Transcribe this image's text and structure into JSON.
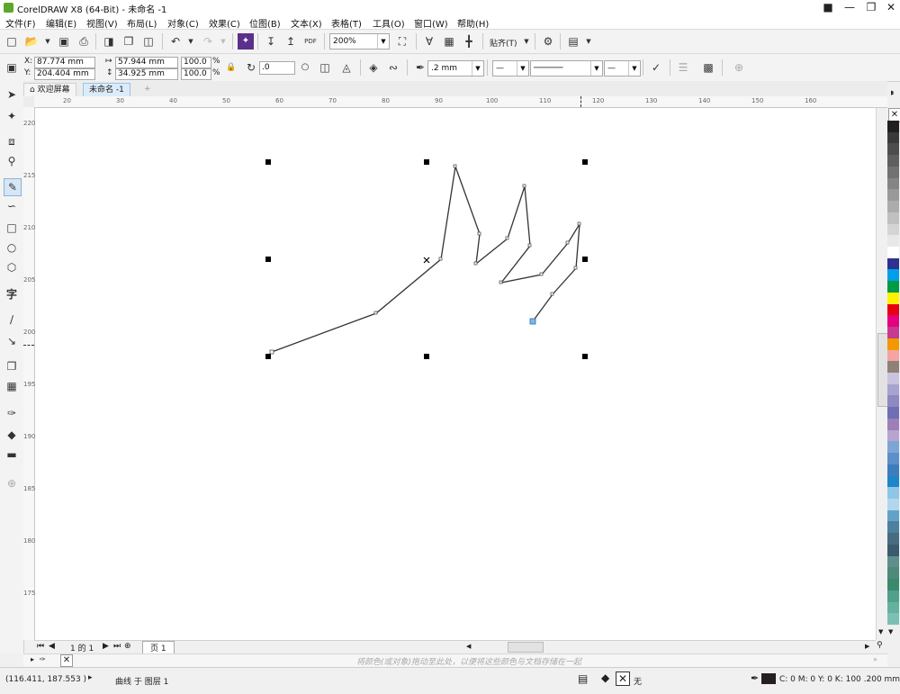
{
  "window": {
    "title": "CorelDRAW X8 (64-Bit) - 未命名 -1"
  },
  "menu": [
    "文件(F)",
    "编辑(E)",
    "视图(V)",
    "布局(L)",
    "对象(C)",
    "效果(C)",
    "位图(B)",
    "文本(X)",
    "表格(T)",
    "工具(O)",
    "窗口(W)",
    "帮助(H)"
  ],
  "toolbar": {
    "zoom": "200%",
    "snap_label": "贴齐(T)",
    "pdf_label": "PDF"
  },
  "property_bar": {
    "x": "87.774 mm",
    "y": "204.404 mm",
    "width": "57.944 mm",
    "height": "34.925 mm",
    "scale_w": "100.0",
    "scale_h": "100.0",
    "pct": "%",
    "x_label": "X:",
    "y_label": "Y:",
    "rotation": ".0",
    "outline_width": ".2 mm"
  },
  "tabs": {
    "welcome": "欢迎屏幕",
    "doc": "未命名 -1"
  },
  "ruler": {
    "h_ticks": [
      "20",
      "30",
      "40",
      "50",
      "60",
      "70",
      "80",
      "90",
      "100",
      "110",
      "120",
      "130",
      "140",
      "150",
      "160"
    ],
    "v_ticks": [
      "220",
      "215",
      "210",
      "205",
      "200",
      "195",
      "190",
      "185",
      "180",
      "175"
    ]
  },
  "page_nav": {
    "page_count": "1 的 1",
    "page_tab": "页 1"
  },
  "doc_palette_hint": "将颜色(或对象)拖动至此处，以便将这些颜色与文档存储在一起",
  "status": {
    "coords": "(116.411, 187.553 )",
    "object_info": "曲线 于 图层 1",
    "fill_label": "无",
    "outline_info": "C: 0 M: 0 Y: 0 K: 100  .200 mm"
  },
  "colors": {
    "accent": "#3b8fd1",
    "palette": [
      "#231f20",
      "#3a3a3a",
      "#4d4d4d",
      "#5f5f5f",
      "#727272",
      "#858585",
      "#999999",
      "#acacac",
      "#c0c0c0",
      "#d4d4d4",
      "#e8e8e8",
      "#ffffff",
      "#2e3192",
      "#00a0e9",
      "#009944",
      "#fff100",
      "#e60012",
      "#e4007f",
      "#c63b8f",
      "#f39800",
      "#f5a3a3",
      "#8f8178",
      "#c9c3e0",
      "#a7a3cf",
      "#8d8ac2",
      "#6f6fb4",
      "#9e7fb8",
      "#b7a5cf",
      "#7da6d6",
      "#5d8fc9",
      "#3d7dbf",
      "#1d86c8",
      "#8ec6e8",
      "#b2d6ee",
      "#62a2c8",
      "#4e7f9e",
      "#486b82",
      "#3a5b6e",
      "#5f8f8c",
      "#4d8a7a",
      "#3a8a6b",
      "#50a08a",
      "#66b0a0",
      "#7cc0b5"
    ]
  }
}
